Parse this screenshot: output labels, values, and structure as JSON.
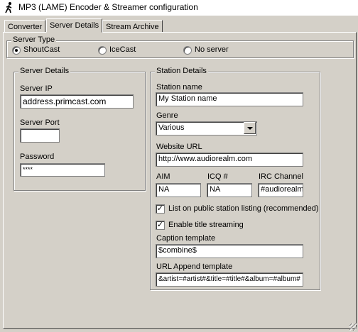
{
  "window": {
    "title": "MP3 (LAME) Encoder & Streamer configuration",
    "icon": "walking-man-icon"
  },
  "tabs": [
    {
      "label": "Converter",
      "active": false
    },
    {
      "label": "Server Details",
      "active": true
    },
    {
      "label": "Stream Archive",
      "active": false
    }
  ],
  "server_type": {
    "legend": "Server Type",
    "options": [
      {
        "label": "ShoutCast",
        "selected": true
      },
      {
        "label": "IceCast",
        "selected": false
      },
      {
        "label": "No server",
        "selected": false
      }
    ]
  },
  "server_details": {
    "legend": "Server Details",
    "ip_label": "Server IP",
    "ip_value": "address.primcast.com",
    "port_label": "Server Port",
    "port_value": "",
    "password_label": "Password",
    "password_value": "****"
  },
  "station_details": {
    "legend": "Station Details",
    "name_label": "Station name",
    "name_value": "My Station name",
    "genre_label": "Genre",
    "genre_value": "Various",
    "website_label": "Website URL",
    "website_value": "http://www.audiorealm.com",
    "aim_label": "AIM",
    "aim_value": "NA",
    "icq_label": "ICQ #",
    "icq_value": "NA",
    "irc_label": "IRC Channel",
    "irc_value": "#audiorealm",
    "list_public_label": "List on public station listing (recommended)",
    "list_public_checked": true,
    "title_streaming_label": "Enable title streaming",
    "title_streaming_checked": true,
    "caption_label": "Caption template",
    "caption_value": "$combine$",
    "url_append_label": "URL Append template",
    "url_append_value": "&artist=#artist#&title=#title#&album=#album#"
  },
  "colors": {
    "face": "#d4d0c8",
    "field": "#ffffff",
    "shadow": "#808080",
    "dark_shadow": "#404040"
  }
}
